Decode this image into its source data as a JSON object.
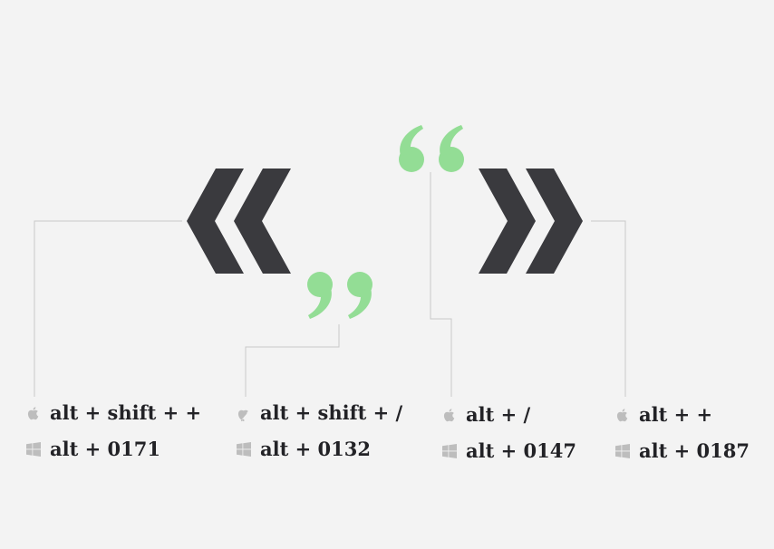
{
  "colors": {
    "background": "#f3f3f3",
    "guillemet": "#3a3a3e",
    "quote": "#93dd95",
    "leader_line": "#c8c8c8",
    "icon": "#bdbdbd",
    "text": "#222226"
  },
  "glyphs": {
    "left_guillemet": "«",
    "right_guillemet": "»",
    "low_double_quote": "„",
    "left_double_quote": "“"
  },
  "columns": [
    {
      "id": "left-guillemet",
      "mac_icon": "apple-icon",
      "mac_shortcut": "alt + shift + +",
      "windows_icon": "windows-icon",
      "windows_shortcut": "alt + 0171"
    },
    {
      "id": "low-double-quote",
      "mac_icon": "apple-icon",
      "mac_shortcut": "alt + shift + /",
      "windows_icon": "windows-icon",
      "windows_shortcut": "alt + 0132"
    },
    {
      "id": "left-double-quote",
      "mac_icon": "apple-icon",
      "mac_shortcut": "alt + /",
      "windows_icon": "windows-icon",
      "windows_shortcut": "alt + 0147"
    },
    {
      "id": "right-guillemet",
      "mac_icon": "apple-icon",
      "mac_shortcut": "alt + +",
      "windows_icon": "windows-icon",
      "windows_shortcut": "alt + 0187"
    }
  ]
}
